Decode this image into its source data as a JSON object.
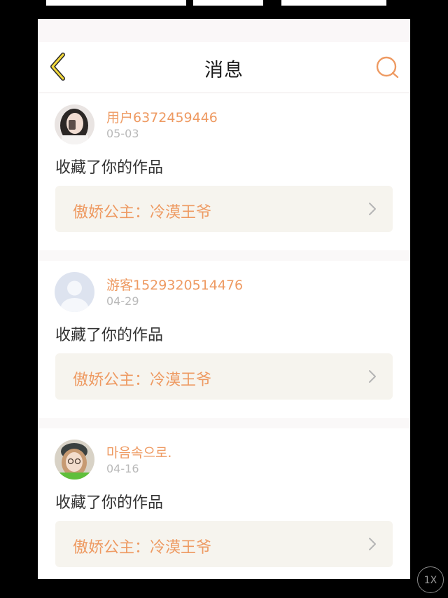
{
  "header": {
    "title": "消息",
    "back_icon": "chevron-left-icon",
    "search_icon": "search-icon"
  },
  "messages": [
    {
      "user": "用户6372459446",
      "date": "05-03",
      "action": "收藏了你的作品",
      "work": "傲娇公主：冷漠王爷"
    },
    {
      "user": "游客1529320514476",
      "date": "04-29",
      "action": "收藏了你的作品",
      "work": "傲娇公主：冷漠王爷"
    },
    {
      "user": "마음속으로.",
      "date": "04-16",
      "action": "收藏了你的作品",
      "work": "傲娇公主：冷漠王爷"
    }
  ],
  "viewer": {
    "zoom": "1X"
  },
  "colors": {
    "accent": "#ee9a62",
    "back_arrow": "#f2d83a",
    "card_link_bg": "#f6f4ee"
  }
}
